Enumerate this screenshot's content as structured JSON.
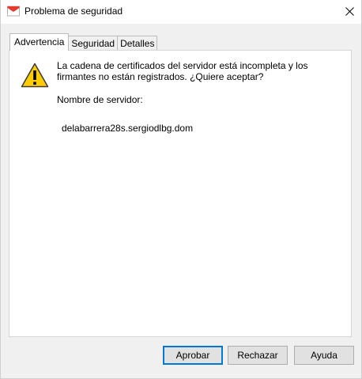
{
  "window": {
    "title": "Problema de seguridad"
  },
  "tabs": [
    {
      "label": "Advertencia",
      "active": true
    },
    {
      "label": "Seguridad",
      "active": false
    },
    {
      "label": "Detalles",
      "active": false
    }
  ],
  "content": {
    "message": "La cadena de certificados del servidor está incompleta y los firmantes no están registrados. ¿Quiere aceptar?",
    "server_label": "Nombre de servidor:",
    "server_name": "delabarrera28s.sergiodlbg.dom"
  },
  "buttons": {
    "accept": "Aprobar",
    "reject": "Rechazar",
    "help": "Ayuda"
  },
  "icons": {
    "app": "envelope-icon",
    "warning": "warning-icon",
    "close": "close-icon"
  },
  "colors": {
    "default_button_border": "#0078d7",
    "warning_fill": "#ffcc00"
  }
}
